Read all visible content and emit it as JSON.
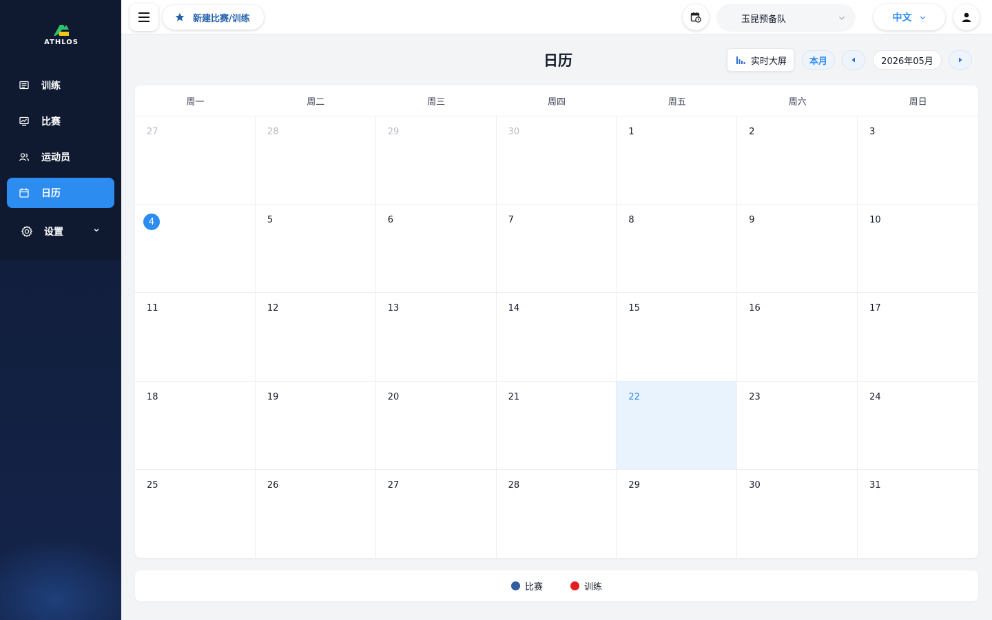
{
  "app": {
    "logo_text": "ATHLOS"
  },
  "sidebar": {
    "items": [
      {
        "label": "训练",
        "icon": "training-icon"
      },
      {
        "label": "比赛",
        "icon": "match-icon"
      },
      {
        "label": "运动员",
        "icon": "athletes-icon"
      },
      {
        "label": "日历",
        "icon": "calendar-icon",
        "active": true
      },
      {
        "label": "设置",
        "icon": "gear-icon",
        "expandable": true
      }
    ]
  },
  "topbar": {
    "new_label": "新建比赛/训练",
    "team": "玉昆预备队",
    "language": "中文"
  },
  "calendar": {
    "title": "日历",
    "live_label": "实时大屏",
    "this_month_label": "本月",
    "current_month": "2026年05月",
    "weekdays": [
      "周一",
      "周二",
      "周三",
      "周四",
      "周五",
      "周六",
      "周日"
    ],
    "days": [
      {
        "d": "27",
        "outside": true
      },
      {
        "d": "28",
        "outside": true
      },
      {
        "d": "29",
        "outside": true
      },
      {
        "d": "30",
        "outside": true
      },
      {
        "d": "1"
      },
      {
        "d": "2"
      },
      {
        "d": "3"
      },
      {
        "d": "4",
        "today": true
      },
      {
        "d": "5"
      },
      {
        "d": "6"
      },
      {
        "d": "7"
      },
      {
        "d": "8"
      },
      {
        "d": "9"
      },
      {
        "d": "10"
      },
      {
        "d": "11"
      },
      {
        "d": "12"
      },
      {
        "d": "13"
      },
      {
        "d": "14"
      },
      {
        "d": "15"
      },
      {
        "d": "16"
      },
      {
        "d": "17"
      },
      {
        "d": "18"
      },
      {
        "d": "19"
      },
      {
        "d": "20"
      },
      {
        "d": "21"
      },
      {
        "d": "22",
        "selected": true
      },
      {
        "d": "23"
      },
      {
        "d": "24"
      },
      {
        "d": "25"
      },
      {
        "d": "26"
      },
      {
        "d": "27"
      },
      {
        "d": "28"
      },
      {
        "d": "29"
      },
      {
        "d": "30"
      },
      {
        "d": "31"
      }
    ]
  },
  "legend": [
    {
      "label": "比赛",
      "color": "#2f5f9e"
    },
    {
      "label": "训练",
      "color": "#e02020"
    }
  ],
  "colors": {
    "accent": "#2d8cf0",
    "sidebar_bg": "#0f1a30"
  }
}
